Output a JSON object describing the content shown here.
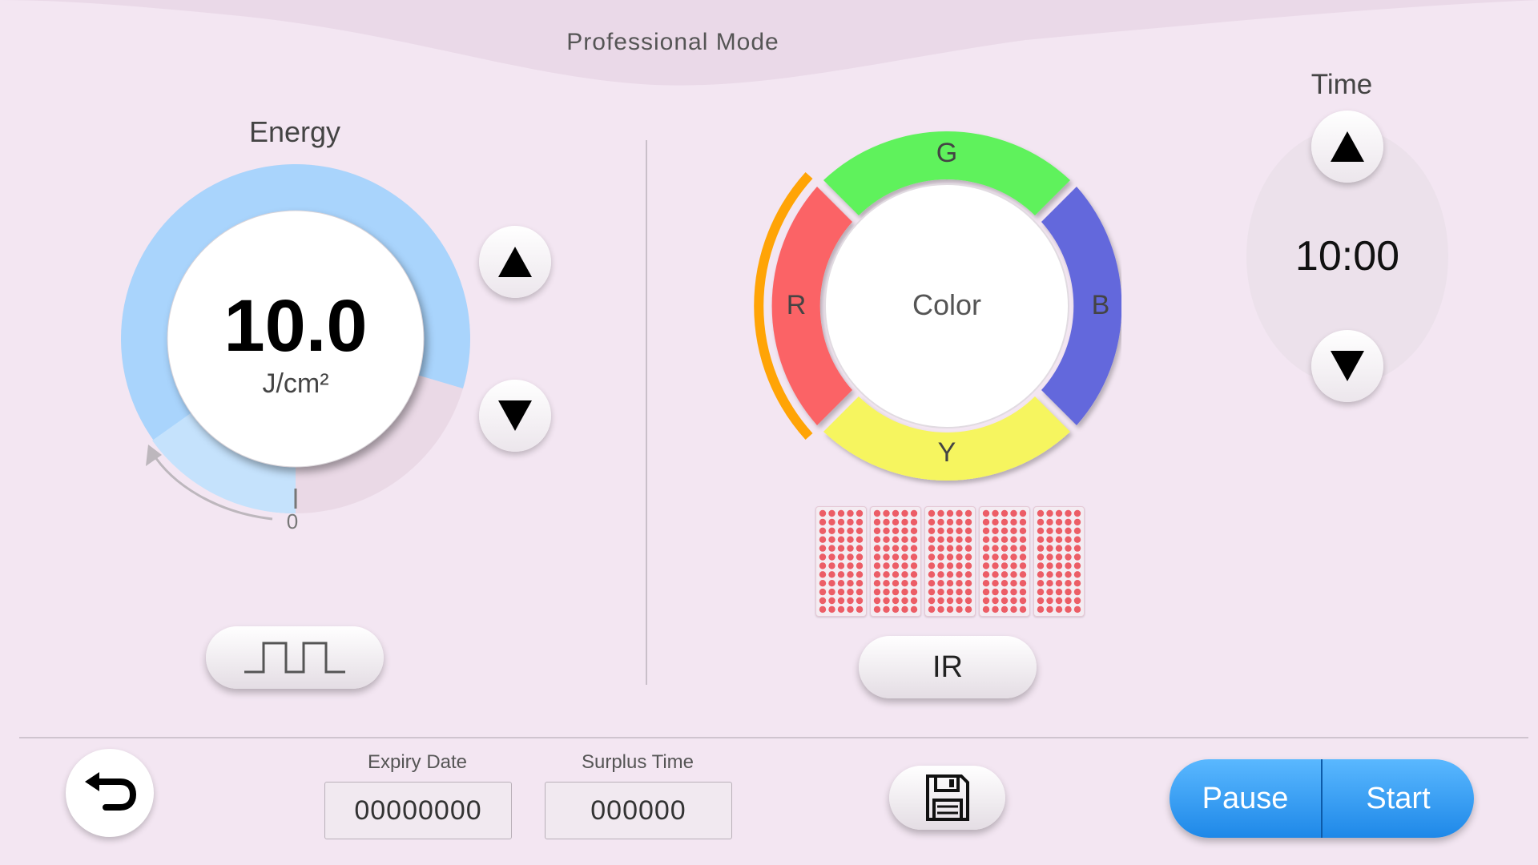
{
  "header": {
    "title": "Professional Mode"
  },
  "energy": {
    "title": "Energy",
    "value": "10.0",
    "unit": "J/cm²",
    "scale_min_label": "0",
    "level_fraction": 0.6
  },
  "color_wheel": {
    "center_label": "Color",
    "segments": [
      {
        "label": "G",
        "color": "#5ef25c"
      },
      {
        "label": "B",
        "color": "#6468dc"
      },
      {
        "label": "Y",
        "color": "#f6f55e"
      },
      {
        "label": "R",
        "color": "#fb6466"
      }
    ],
    "selected": "R",
    "selection_color": "#ffa406"
  },
  "ir_button": {
    "label": "IR"
  },
  "time": {
    "title": "Time",
    "value": "10:00"
  },
  "footer": {
    "expiry_label": "Expiry Date",
    "expiry_value": "00000000",
    "surplus_label": "Surplus Time",
    "surplus_value": "000000",
    "pause_label": "Pause",
    "start_label": "Start"
  },
  "icons": {
    "back": "back-arrow-icon",
    "save": "floppy-disk-icon",
    "pulse": "square-wave-icon",
    "up": "triangle-up-icon",
    "down": "triangle-down-icon"
  },
  "colors": {
    "background": "#f3e6f2",
    "energy_arc": "#a8d3fc",
    "action_blue": "#2a95f0"
  }
}
